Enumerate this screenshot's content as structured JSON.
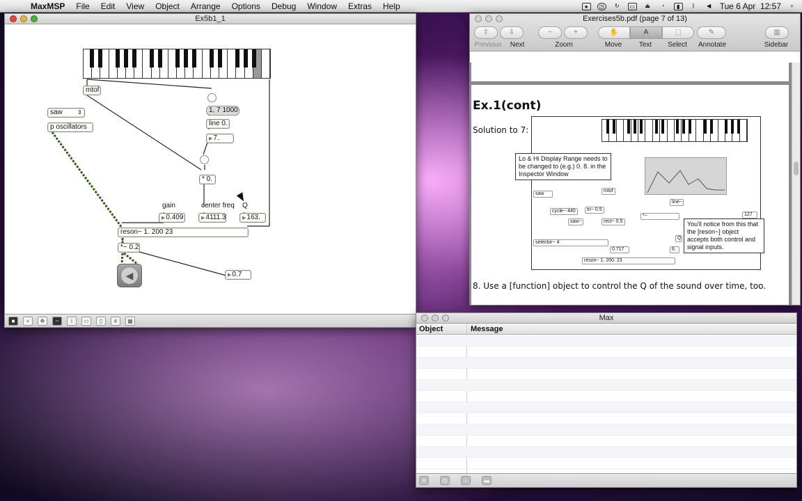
{
  "menubar": {
    "app": "MaxMSP",
    "items": [
      "File",
      "Edit",
      "View",
      "Object",
      "Arrange",
      "Options",
      "Debug",
      "Window",
      "Extras",
      "Help"
    ],
    "clock": "Tue 6 Apr  12:57"
  },
  "patcher": {
    "title": "Ex5b1_1",
    "labels": {
      "gain": "gain",
      "center_freq": "center freq",
      "q": "Q"
    },
    "objects": {
      "mtof": "mtof",
      "umenu": "saw",
      "p_osc": "p oscillators",
      "msg_line": "1, 7 1000",
      "line": "line 0.",
      "num7": "7.",
      "mult": "* 0.",
      "gain_num": "0.409",
      "freq_num": "4111.3",
      "q_num": "163.",
      "reson": "reson~ 1. 200 23",
      "times": "*~ 0.2",
      "out_num": "0.7"
    }
  },
  "pdf": {
    "title": "Exercises5b.pdf (page 7 of 13)",
    "toolbar": {
      "previous": "Previous",
      "next": "Next",
      "zoom": "Zoom",
      "move": "Move",
      "text": "Text",
      "select": "Select",
      "annotate": "Annotate",
      "sidebar": "Sidebar"
    },
    "heading": "Ex.1(cont)",
    "solution": "Solution to 7:",
    "callout1": "Lo & Hi Display Range needs to be changed to (e.g.) 0. 8. in the Inspector Window",
    "callout2": "You'll notice from this that the [reson~] object accepts both control and signal inputs.",
    "fig_objects": {
      "saw": "saw",
      "mtof": "mtof",
      "cycle": "cycle~ 440",
      "tri": "tri~ 0.5",
      "sawt": "saw~",
      "rect": "rect~ 0.5",
      "line": "line~",
      "mult": "*~",
      "selector": "selector~ 4",
      "n717": "0.717",
      "n6": "6.",
      "n127": "127",
      "q": "Q",
      "reson": "reson~ 1. 200. 23"
    },
    "item8": "8. Use a [function] object to control the Q of the sound over time, too."
  },
  "console": {
    "title": "Max",
    "col_object": "Object",
    "col_message": "Message"
  }
}
